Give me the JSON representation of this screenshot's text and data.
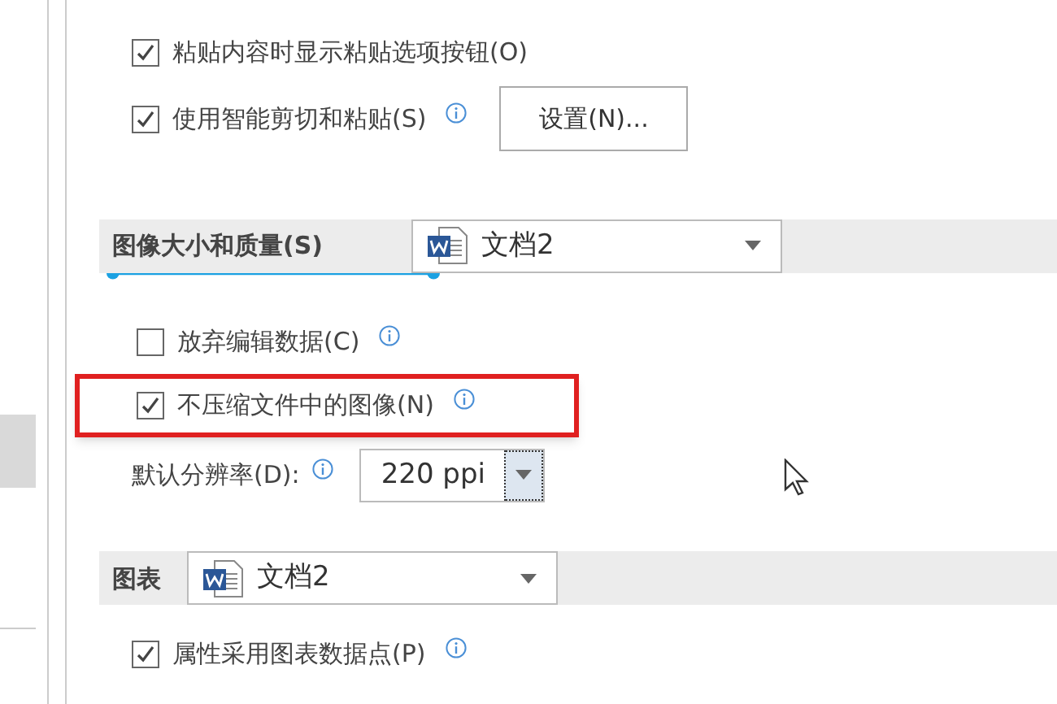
{
  "sidebar": {
    "items": [
      {
        "selected": true
      }
    ]
  },
  "cut_options": [
    {
      "label": "粘贴内容时显示粘贴选项按钮(O)",
      "checked": true,
      "info": false
    },
    {
      "label": "使用智能剪切和粘贴(S)",
      "checked": true,
      "info": true,
      "button": "设置(N)..."
    }
  ],
  "image_section": {
    "title": "图像大小和质量(S)",
    "document": "文档2",
    "options": [
      {
        "label": "放弃编辑数据(C)",
        "checked": false,
        "highlighted": false
      },
      {
        "label": "不压缩文件中的图像(N)",
        "checked": true,
        "highlighted": true
      }
    ],
    "resolution": {
      "label": "默认分辨率(D):",
      "value": "220 ppi"
    }
  },
  "chart_section": {
    "title": "图表",
    "document": "文档2",
    "options": [
      {
        "label": "属性采用图表数据点(P)",
        "checked": true
      }
    ]
  }
}
